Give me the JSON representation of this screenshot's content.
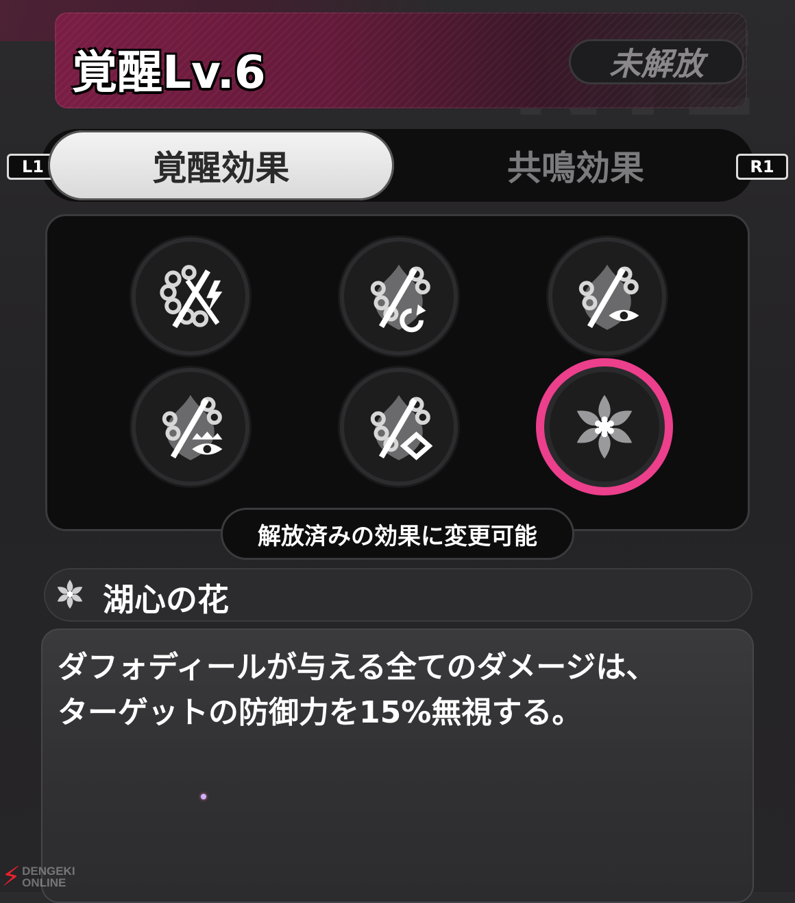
{
  "header": {
    "title": "覚醒Lv.6",
    "status": "未解放"
  },
  "tabs": {
    "left_key": "L1",
    "right_key": "R1",
    "items": [
      {
        "label": "覚醒効果",
        "active": true
      },
      {
        "label": "共鳴効果",
        "active": false
      }
    ]
  },
  "grid": {
    "slots": [
      {
        "icon": "chain-spear-lightning-icon",
        "selected": false
      },
      {
        "icon": "chain-spear-refresh-icon",
        "selected": false
      },
      {
        "icon": "chain-spear-eye-icon",
        "selected": false
      },
      {
        "icon": "chain-spear-crowned-eye-icon",
        "selected": false
      },
      {
        "icon": "chain-spear-diamond-icon",
        "selected": false
      },
      {
        "icon": "lotus-flower-icon",
        "selected": true
      }
    ],
    "hint": "解放済みの効果に変更可能",
    "selected_color": "#ec3f8c"
  },
  "effect": {
    "icon": "lotus-flower-icon",
    "name": "湖心の花",
    "description_line1": "ダフォディールが与える全てのダメージは、",
    "description_line2": "ターゲットの防御力を15%無視する。"
  },
  "watermark": {
    "text_line1": "DENGEKI",
    "text_line2": "ONLINE"
  }
}
